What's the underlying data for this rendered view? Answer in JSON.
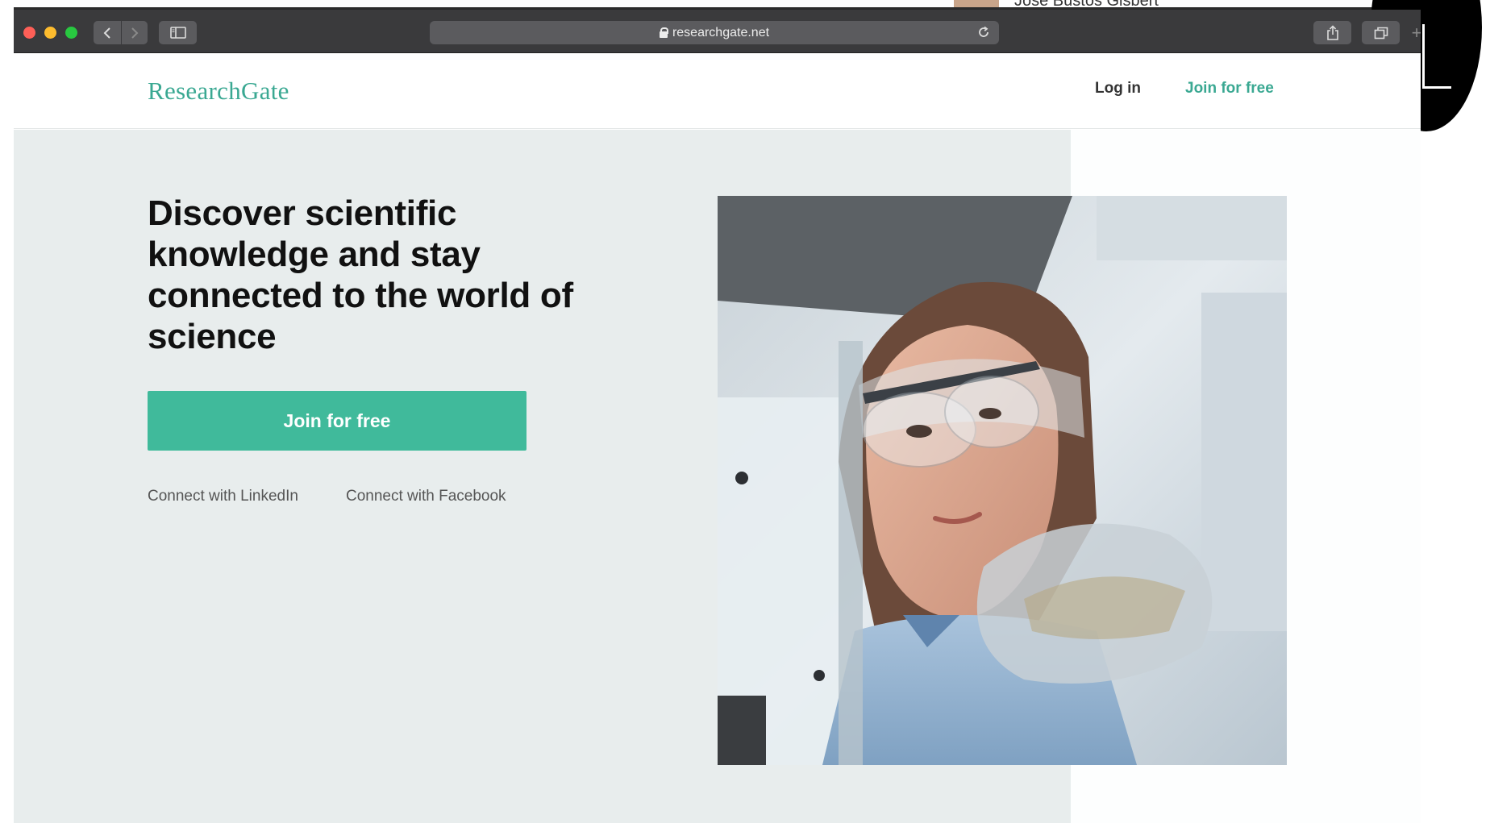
{
  "top_strip": {
    "name_text": "Jose Bustos Gisbert"
  },
  "browser": {
    "url": "researchgate.net",
    "icons": {
      "back": "chevron-left-icon",
      "forward": "chevron-right-icon",
      "sidebar": "sidebar-icon",
      "lock": "lock-icon",
      "reload": "reload-icon",
      "share": "share-icon",
      "tabs": "tabs-icon",
      "new_tab": "plus-icon"
    }
  },
  "site": {
    "logo": "ResearchGate",
    "nav": {
      "login": "Log in",
      "join": "Join for free"
    }
  },
  "hero": {
    "headline": "Discover scientific knowledge and stay connected to the world of science",
    "cta_label": "Join for free",
    "connect_linkedin": "Connect with LinkedIn",
    "connect_facebook": "Connect with Facebook"
  },
  "colors": {
    "brand": "#40ba9b",
    "logo": "#3aa892",
    "hero_bg": "#e8eded",
    "toolbar": "#3a3a3c"
  }
}
